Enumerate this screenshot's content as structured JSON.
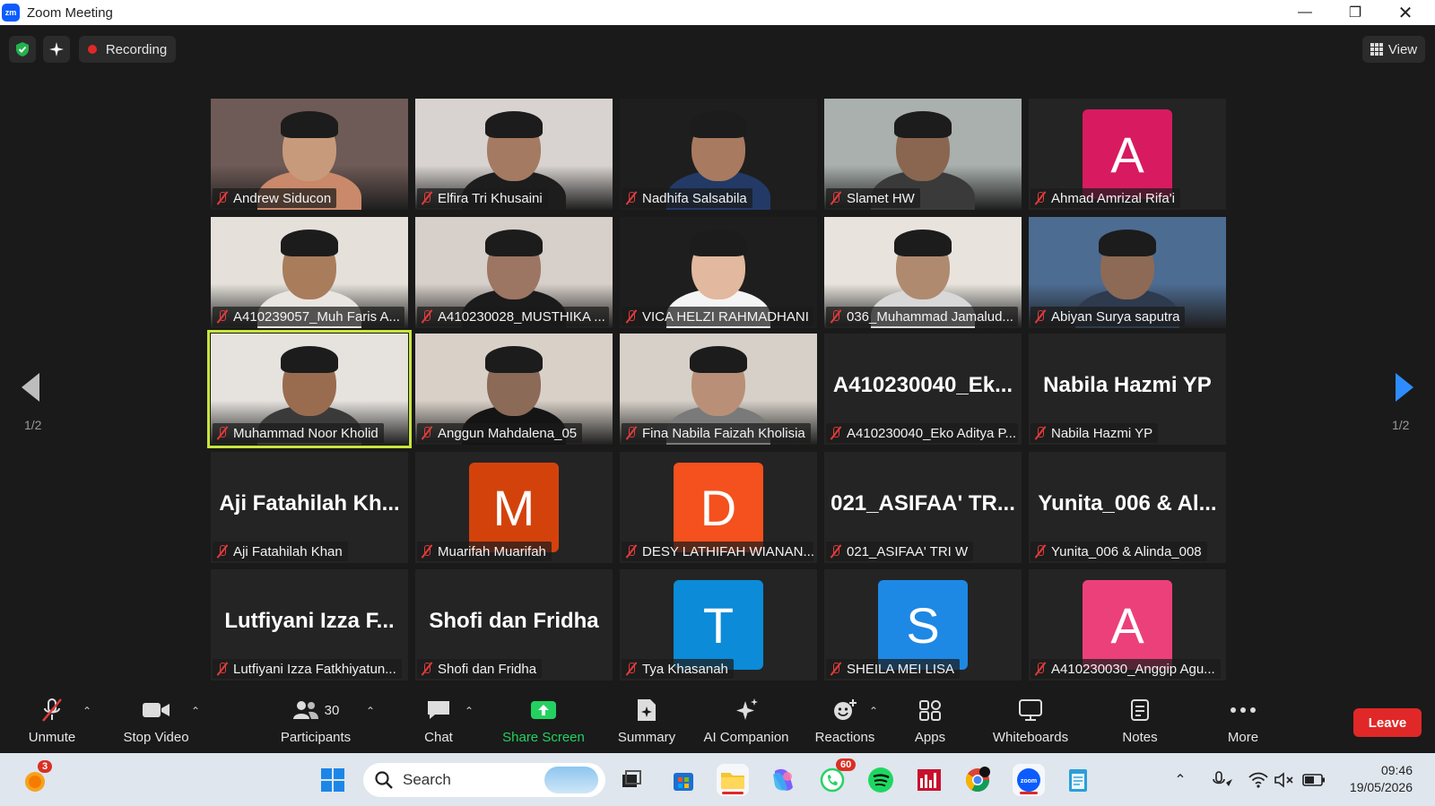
{
  "window": {
    "title": "Zoom Meeting",
    "logo": "zm"
  },
  "topbar": {
    "recording_label": "Recording",
    "view_label": "View"
  },
  "grid": {
    "page_indicator": "1/2",
    "tiles": [
      {
        "name": "Andrew Siducon",
        "kind": "video",
        "bg": "#6e5a56",
        "skin": "#c89a7c",
        "shirt": "#c9896a"
      },
      {
        "name": "Elfira Tri Khusaini",
        "kind": "video",
        "bg": "#d8d3d0",
        "skin": "#a47a62",
        "shirt": "#1d1d1d"
      },
      {
        "name": "Nadhifa Salsabila",
        "kind": "video",
        "bg": "#1e1e1e",
        "skin": "#a87a60",
        "shirt": "#233a66"
      },
      {
        "name": "Slamet HW",
        "kind": "video",
        "bg": "#a9b0ad",
        "skin": "#8a6650",
        "shirt": "#3a3a3a"
      },
      {
        "name": "Ahmad Amrizal Rifa'i",
        "kind": "avatar",
        "letter": "A",
        "color": "#d81b60"
      },
      {
        "name": "A410239057_Muh Faris A...",
        "kind": "video",
        "bg": "#e5e1da",
        "skin": "#a97c5c",
        "shirt": "#e9e6e2"
      },
      {
        "name": "A410230028_MUSTHIKA ...",
        "kind": "video",
        "bg": "#d7cfc9",
        "skin": "#9c7563",
        "shirt": "#1b1b1b"
      },
      {
        "name": "VICA HELZI RAHMADHANI",
        "kind": "video",
        "bg": "#1e1e1e",
        "skin": "#e2b89e",
        "shirt": "#f4f4f4"
      },
      {
        "name": "036_Muhammad Jamalud...",
        "kind": "video",
        "bg": "#e8e4dd",
        "skin": "#b08a6e",
        "shirt": "#d8d8d8"
      },
      {
        "name": "Abiyan Surya saputra",
        "kind": "video",
        "bg": "#4d6c92",
        "skin": "#8c6a55",
        "shirt": "#2e3a4e"
      },
      {
        "name": "Muhammad Noor Kholid",
        "kind": "video",
        "bg": "#e6e3df",
        "skin": "#9a6c4f",
        "shirt": "#3a3a3a",
        "active": true
      },
      {
        "name": "Anggun Mahdalena_05",
        "kind": "video",
        "bg": "#d9d1c8",
        "skin": "#8b6a58",
        "shirt": "#141414"
      },
      {
        "name": "Fina Nabila Faizah Kholisia",
        "kind": "video",
        "bg": "#d6d0c8",
        "skin": "#b99077",
        "shirt": "#7a7a7a"
      },
      {
        "name": "A410230040_Eko Aditya P...",
        "kind": "text",
        "display": "A410230040_Ek..."
      },
      {
        "name": "Nabila Hazmi YP",
        "kind": "text",
        "display": "Nabila Hazmi YP"
      },
      {
        "name": "Aji Fatahilah Khan",
        "kind": "text",
        "display": "Aji Fatahilah Kh..."
      },
      {
        "name": "Muarifah Muarifah",
        "kind": "avatar",
        "letter": "M",
        "color": "#d4420c"
      },
      {
        "name": "DESY LATHIFAH WIANAN...",
        "kind": "avatar",
        "letter": "D",
        "color": "#f4511e"
      },
      {
        "name": "021_ASIFAA' TRI W",
        "kind": "text",
        "display": "021_ASIFAA' TR..."
      },
      {
        "name": "Yunita_006 & Alinda_008",
        "kind": "text",
        "display": "Yunita_006 & Al..."
      },
      {
        "name": "Lutfiyani Izza Fatkhiyatun...",
        "kind": "text",
        "display": "Lutfiyani Izza F..."
      },
      {
        "name": "Shofi dan Fridha",
        "kind": "text",
        "display": "Shofi dan Fridha"
      },
      {
        "name": "Tya Khasanah",
        "kind": "avatar",
        "letter": "T",
        "color": "#0b8bd8"
      },
      {
        "name": "SHEILA MEI LISA",
        "kind": "avatar",
        "letter": "S",
        "color": "#1e88e5"
      },
      {
        "name": "A410230030_Anggip Agu...",
        "kind": "avatar",
        "letter": "A",
        "color": "#ec407a"
      }
    ]
  },
  "toolbar": {
    "unmute": "Unmute",
    "stop_video": "Stop Video",
    "participants": "Participants",
    "participants_count": "30",
    "chat": "Chat",
    "share_screen": "Share Screen",
    "summary": "Summary",
    "ai_companion": "AI Companion",
    "reactions": "Reactions",
    "apps": "Apps",
    "whiteboards": "Whiteboards",
    "notes": "Notes",
    "more": "More",
    "leave": "Leave"
  },
  "taskbar": {
    "search_placeholder": "Search",
    "weather_badge": "3",
    "whatsapp_badge": "60",
    "time": "09:46",
    "date": "19/05/2026"
  },
  "colors": {
    "accent_green": "#23d160",
    "leave_red": "#e02828",
    "active_speaker": "#c8e63c",
    "nav_blue": "#2d8cff"
  }
}
